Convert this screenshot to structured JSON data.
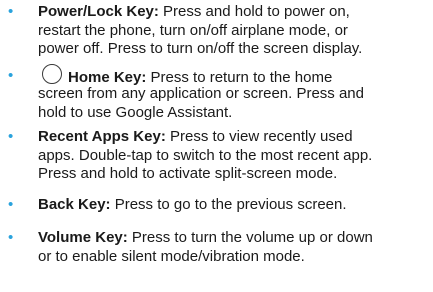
{
  "items": [
    {
      "term": "Power/Lock Key:",
      "line1": "Press and hold to power on,",
      "line2": "restart the phone, turn on/off airplane mode, or",
      "line3": "power off. Press to turn on/off the screen display."
    },
    {
      "icon": "home-circle-icon",
      "term": "Home Key:",
      "line1": "Press to return to the home",
      "line2": "screen from any application or screen. Press and",
      "line3": "hold to use Google Assistant."
    },
    {
      "term": "Recent Apps Key:",
      "line1": "Press to view recently used",
      "line2": "apps. Double-tap to switch to the most recent app.",
      "line3": "Press and hold to activate split-screen mode."
    },
    {
      "term": "Back Key:",
      "line1": "Press to go to the previous screen."
    },
    {
      "term": "Volume Key:",
      "line1": "Press to turn the volume up or down",
      "line2": "or to enable silent mode/vibration mode."
    }
  ],
  "bullet_glyph": "•",
  "colors": {
    "bullet": "#2aa3dd",
    "text": "#1a1a1a"
  }
}
